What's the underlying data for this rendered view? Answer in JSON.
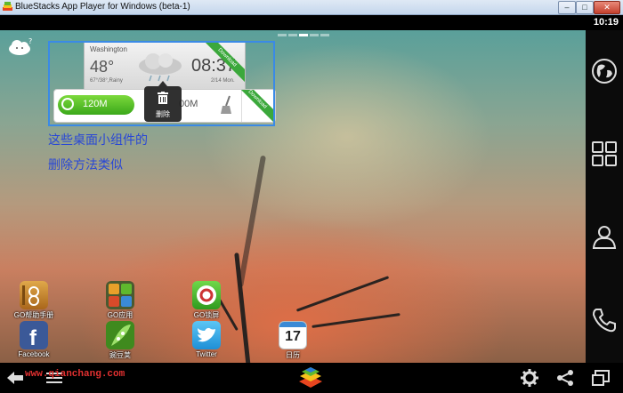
{
  "window": {
    "title": "BlueStacks App Player for Windows (beta-1)",
    "controls": {
      "minimize": "–",
      "maximize": "□",
      "close": "✕"
    }
  },
  "status": {
    "time": "10:19"
  },
  "home": {
    "page_indicator": {
      "pages": 5,
      "current": 3
    },
    "weather_widget": {
      "city": "Washington",
      "temperature": "48°",
      "conditions": "67°/38°,Rainy",
      "time": "08:37",
      "date": "2/14 Mon.",
      "ribbon": "Download"
    },
    "cleaner_widget": {
      "memory_left": "120M",
      "memory_right": "00M",
      "ribbon": "Download"
    },
    "delete_popup": {
      "label": "删除",
      "icon": "trash-icon"
    },
    "annotation": {
      "line1": "这些桌面小组件的",
      "line2": "删除方法类似"
    },
    "apps_row1": [
      {
        "label": "GO帮助手册",
        "icon": "notebook-icon",
        "color": "#c98a2a"
      },
      {
        "label": "GO应用",
        "icon": "app-grid-icon",
        "color": "#4a7a2e"
      },
      {
        "label": "GO锁屏",
        "icon": "lock-screen-icon",
        "color": "#3fae3a"
      }
    ],
    "apps_row2": [
      {
        "label": "Facebook",
        "icon": "facebook-icon",
        "color": "#3b5998"
      },
      {
        "label": "豌豆荚",
        "icon": "pea-pod-icon",
        "color": "#5fb82e"
      },
      {
        "label": "Twitter",
        "icon": "twitter-icon",
        "color": "#2aa3e8"
      },
      {
        "label": "日历",
        "icon": "calendar-icon",
        "color": "#ffffff",
        "badge": "17"
      }
    ]
  },
  "sidebar": {
    "items": [
      {
        "icon": "globe-icon"
      },
      {
        "icon": "apps-grid-icon"
      },
      {
        "icon": "contacts-icon"
      },
      {
        "icon": "phone-icon"
      }
    ]
  },
  "navbar": {
    "watermark": "www.qianchang.com",
    "icons": [
      "back-icon",
      "menu-icon",
      "bluestacks-logo-icon",
      "settings-icon",
      "share-icon",
      "window-icon"
    ]
  }
}
